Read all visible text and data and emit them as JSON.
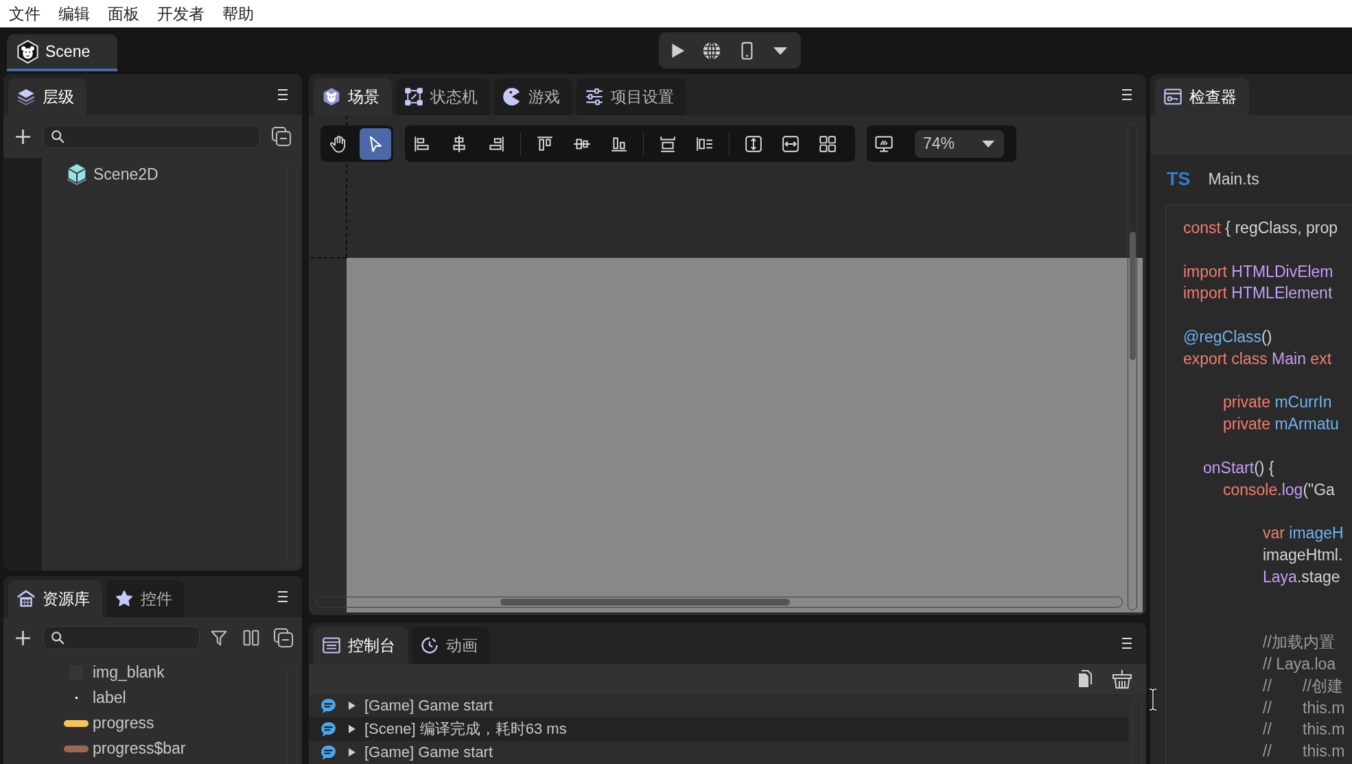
{
  "menu": [
    "文件",
    "编辑",
    "面板",
    "开发者",
    "帮助"
  ],
  "documents": [
    {
      "label": "Scene",
      "selected": true
    }
  ],
  "hierarchy": {
    "tabs": [
      {
        "label": "层级",
        "selected": true
      }
    ],
    "tree": [
      {
        "label": "Scene2D"
      }
    ]
  },
  "assets": {
    "tabs": [
      {
        "label": "资源库",
        "selected": true
      },
      {
        "label": "控件",
        "selected": false
      }
    ],
    "items": [
      {
        "name": "img_blank",
        "kind": "square",
        "color": "#35363c"
      },
      {
        "name": "label",
        "kind": "dot",
        "color": "#ffffff"
      },
      {
        "name": "progress",
        "kind": "bar",
        "color": "#f7c35c"
      },
      {
        "name": "progress$bar",
        "kind": "bar",
        "color": "#9a6753"
      }
    ]
  },
  "scene": {
    "tabs": [
      {
        "label": "场景",
        "selected": true
      },
      {
        "label": "状态机",
        "selected": false
      },
      {
        "label": "游戏",
        "selected": false
      },
      {
        "label": "项目设置",
        "selected": false
      }
    ],
    "tools": [
      {
        "selected": false
      },
      {
        "selected": true
      }
    ],
    "zoom": "74%"
  },
  "console": {
    "tabs": [
      {
        "label": "控制台",
        "selected": true
      },
      {
        "label": "动画",
        "selected": false
      }
    ],
    "logs": [
      {
        "text": "[Game] Game start",
        "expanded": false
      },
      {
        "text": "[Scene] 编译完成，耗时63 ms",
        "expanded": false
      },
      {
        "text": "[Game] Game start",
        "expanded": false
      }
    ]
  },
  "inspector": {
    "tabs": [
      {
        "label": "检查器",
        "selected": true
      }
    ],
    "file": {
      "badge": "TS",
      "name": "Main.ts"
    },
    "code": [
      {
        "kind": "code",
        "tokens": [
          {
            "kind": "keyword",
            "text": "const"
          },
          {
            "kind": "plain",
            "text": " { regClass, prop"
          }
        ]
      },
      {
        "kind": "blank"
      },
      {
        "kind": "code",
        "tokens": [
          {
            "kind": "keyword",
            "text": "import"
          },
          {
            "kind": "type",
            "text": " HTMLDivElem"
          }
        ]
      },
      {
        "kind": "code",
        "tokens": [
          {
            "kind": "keyword",
            "text": "import"
          },
          {
            "kind": "type",
            "text": " HTMLElement"
          }
        ]
      },
      {
        "kind": "blank"
      },
      {
        "kind": "code",
        "tokens": [
          {
            "kind": "name",
            "text": "@regClass"
          },
          {
            "kind": "plain",
            "text": "()"
          }
        ]
      },
      {
        "kind": "code",
        "tokens": [
          {
            "kind": "keyword",
            "text": "export class"
          },
          {
            "kind": "type",
            "text": " Main"
          },
          {
            "kind": "keyword",
            "text": " ext"
          }
        ]
      },
      {
        "kind": "blank"
      },
      {
        "kind": "code",
        "tokens": [
          {
            "kind": "keyword",
            "text": "\t\tprivate"
          },
          {
            "kind": "name",
            "text": " mCurrIn"
          }
        ]
      },
      {
        "kind": "code",
        "tokens": [
          {
            "kind": "keyword",
            "text": "\t\tprivate"
          },
          {
            "kind": "name",
            "text": " mArmatu"
          }
        ]
      },
      {
        "kind": "blank"
      },
      {
        "kind": "code",
        "tokens": [
          {
            "kind": "type",
            "text": "\tonStart"
          },
          {
            "kind": "plain",
            "text": "() {"
          }
        ]
      },
      {
        "kind": "code",
        "tokens": [
          {
            "kind": "keyword",
            "text": "\t\tconsole"
          },
          {
            "kind": "type",
            "text": ".log"
          },
          {
            "kind": "plain",
            "text": "(\"Ga"
          }
        ]
      },
      {
        "kind": "blank"
      },
      {
        "kind": "code",
        "tokens": [
          {
            "kind": "keyword",
            "text": "\t\t\t\tvar"
          },
          {
            "kind": "name",
            "text": " imageH"
          }
        ]
      },
      {
        "kind": "code",
        "tokens": [
          {
            "kind": "plain",
            "text": "\t\t\t\timageHtml."
          }
        ]
      },
      {
        "kind": "code",
        "tokens": [
          {
            "kind": "type",
            "text": "\t\t\t\tLaya"
          },
          {
            "kind": "plain",
            "text": ".stage"
          }
        ]
      },
      {
        "kind": "blank"
      },
      {
        "kind": "blank"
      },
      {
        "kind": "code",
        "tokens": [
          {
            "kind": "comment",
            "text": "\t\t\t\t//加载内置"
          }
        ]
      },
      {
        "kind": "code",
        "tokens": [
          {
            "kind": "comment",
            "text": "\t\t\t\t// Laya.loa"
          }
        ]
      },
      {
        "kind": "code",
        "tokens": [
          {
            "kind": "comment",
            "text": "\t\t\t\t//\t\t//创建"
          }
        ]
      },
      {
        "kind": "code",
        "tokens": [
          {
            "kind": "comment",
            "text": "\t\t\t\t//\t\tthis.m"
          }
        ]
      },
      {
        "kind": "code",
        "tokens": [
          {
            "kind": "comment",
            "text": "\t\t\t\t//\t\tthis.m"
          }
        ]
      },
      {
        "kind": "code",
        "tokens": [
          {
            "kind": "comment",
            "text": "\t\t\t\t//\t\tthis.m"
          }
        ]
      }
    ]
  }
}
